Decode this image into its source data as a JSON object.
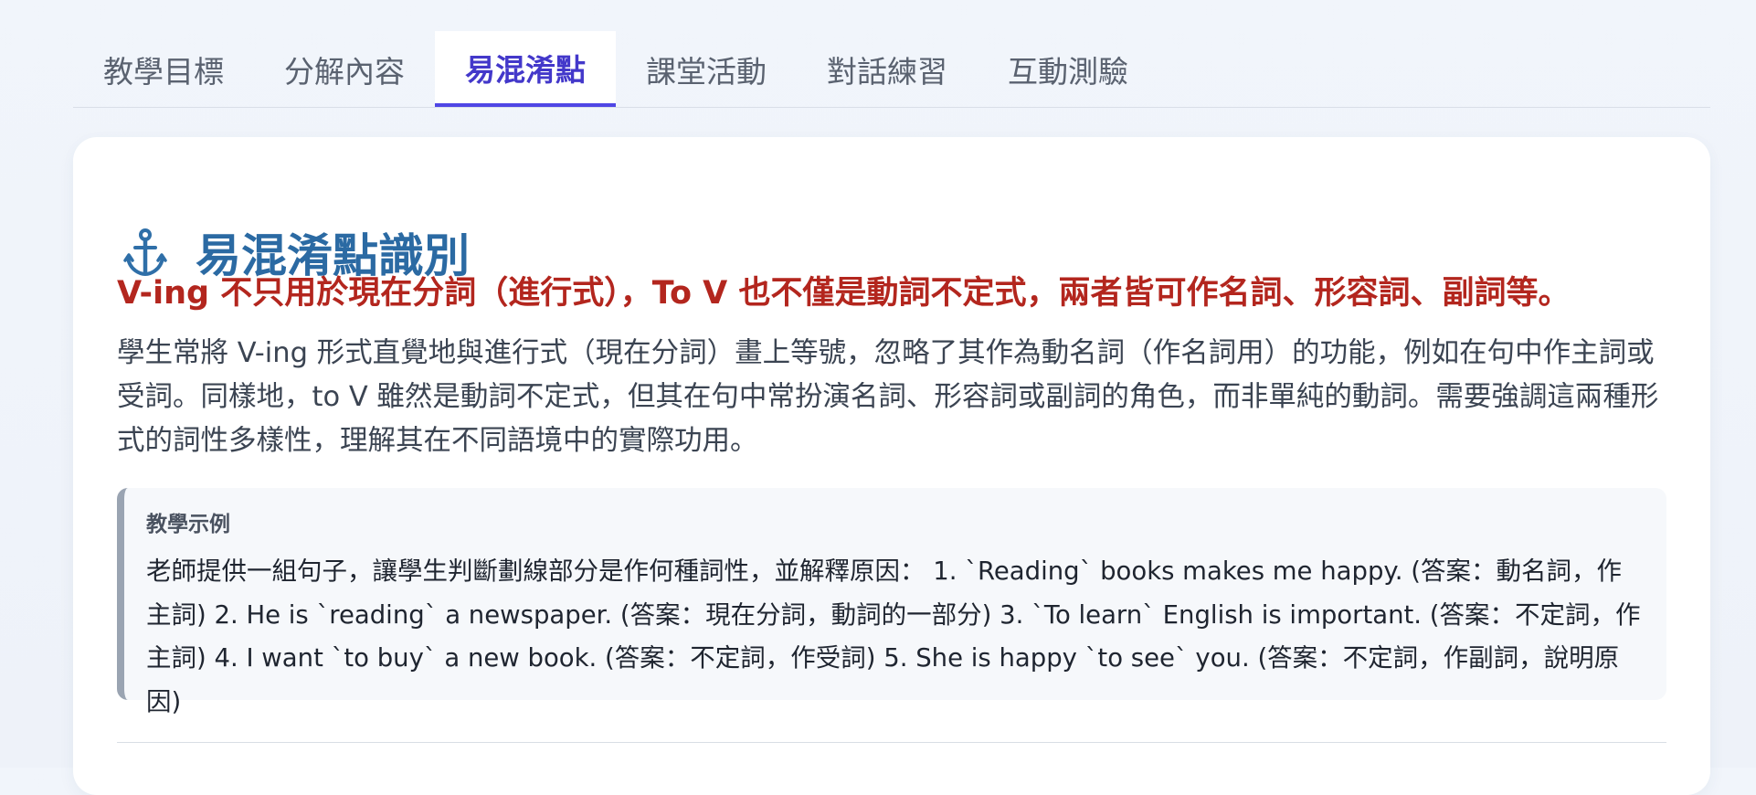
{
  "tabs": [
    {
      "label": "教學目標"
    },
    {
      "label": "分解內容"
    },
    {
      "label": "易混淆點"
    },
    {
      "label": "課堂活動"
    },
    {
      "label": "對話練習"
    },
    {
      "label": "互動測驗"
    }
  ],
  "active_tab": "易混淆點",
  "section": {
    "icon": "anchor-icon",
    "title": "易混淆點識別",
    "highlight": "V-ing 不只用於現在分詞（進行式），To V 也不僅是動詞不定式，兩者皆可作名詞、形容詞、副詞等。",
    "description": "學生常將 V-ing 形式直覺地與進行式（現在分詞）畫上等號，忽略了其作為動名詞（作名詞用）的功能，例如在句中作主詞或受詞。同樣地，to V 雖然是動詞不定式，但其在句中常扮演名詞、形容詞或副詞的角色，而非單純的動詞。需要強調這兩種形式的詞性多樣性，理解其在不同語境中的實際功用。",
    "example": {
      "label": "教學示例",
      "text": "老師提供一組句子，讓學生判斷劃線部分是作何種詞性，並解釋原因： 1. `Reading` books makes me happy. (答案：動名詞，作主詞) 2. He is `reading` a newspaper. (答案：現在分詞，動詞的一部分) 3. `To learn` English is important. (答案：不定詞，作主詞) 4. I want `to buy` a new book. (答案：不定詞，作受詞) 5. She is happy `to see` you. (答案：不定詞，作副詞，說明原因)"
    }
  },
  "colors": {
    "active_tab": "#4338ca",
    "active_underline": "#4f46e5",
    "title": "#2b6aa3",
    "highlight": "#b3261e",
    "example_border": "#9aa4b2"
  }
}
